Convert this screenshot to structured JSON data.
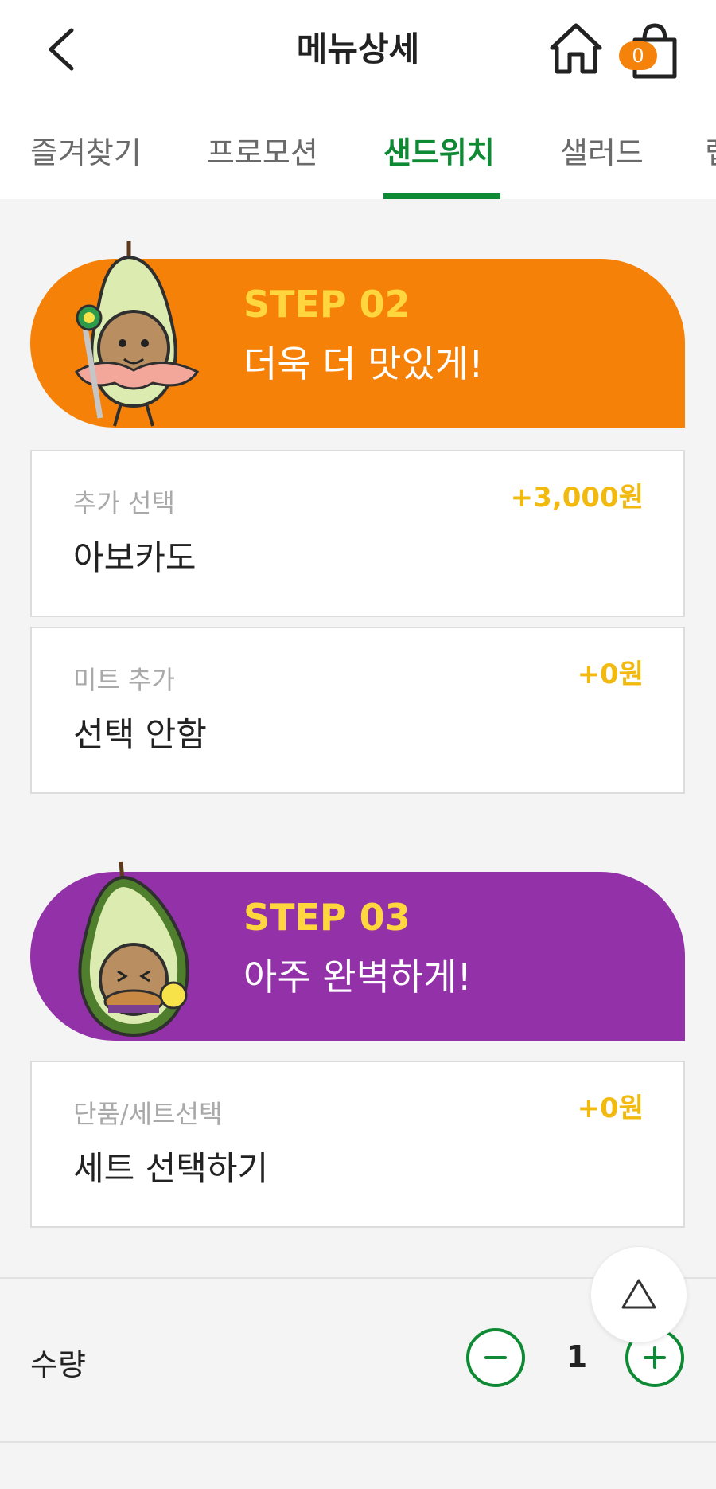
{
  "header": {
    "title": "메뉴상세",
    "cart_count": "0"
  },
  "tabs": [
    {
      "label": "즐겨찾기"
    },
    {
      "label": "프로모션"
    },
    {
      "label": "샌드위치"
    },
    {
      "label": "샐러드"
    },
    {
      "label": "랩"
    }
  ],
  "steps": [
    {
      "step": "STEP 02",
      "headline": "더욱 더 맛있게!"
    },
    {
      "step": "STEP 03",
      "headline": "아주 완벽하게!"
    }
  ],
  "options": [
    {
      "label": "추가 선택",
      "value": "아보카도",
      "price": "+3,000원"
    },
    {
      "label": "미트 추가",
      "value": "선택 안함",
      "price": "+0원"
    },
    {
      "label": "단품/세트선택",
      "value": "세트 선택하기",
      "price": "+0원"
    }
  ],
  "quantity": {
    "label": "수량",
    "value": "1"
  },
  "colors": {
    "brand_green": "#0f8a34",
    "step02_orange": "#f68108",
    "step03_purple": "#9331a8",
    "step_yellow": "#ffd63d",
    "price_yellow": "#f2b90f"
  },
  "icons": [
    "back-arrow-icon",
    "home-icon",
    "shopping-bag-icon",
    "scroll-top-icon",
    "minus-icon",
    "plus-icon",
    "avocado-mascot-icon"
  ]
}
